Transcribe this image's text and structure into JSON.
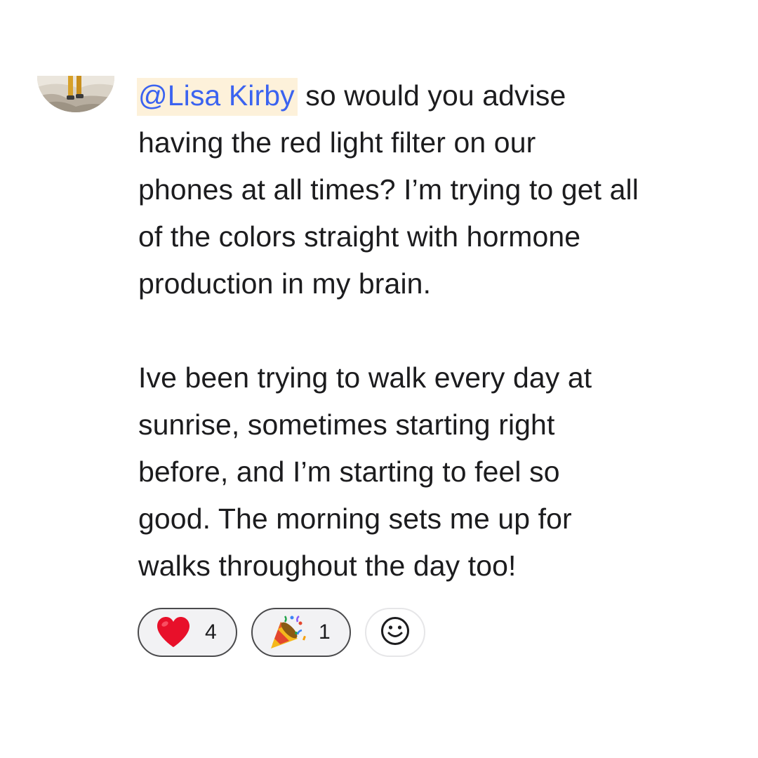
{
  "message": {
    "mention": "@Lisa Kirby",
    "paragraph_1_rest": " so would you advise\nhaving the red light filter on our\nphones at all times? I’m trying to get all\nof the colors straight with hormone\nproduction in my brain.",
    "paragraph_2": "Ive been trying to walk every day at\nsunrise, sometimes starting right\nbefore, and I’m starting to feel so\ngood. The morning sets me up for\nwalks throughout the day too!"
  },
  "reactions": [
    {
      "emoji": "heart-icon",
      "count": "4"
    },
    {
      "emoji": "party-popper-icon",
      "count": "1"
    }
  ],
  "add_reaction": {
    "icon": "smiley-face-icon"
  },
  "colors": {
    "mention_text": "#3b63f0",
    "mention_bg": "#fdf1da",
    "heart": "#e8102a"
  }
}
